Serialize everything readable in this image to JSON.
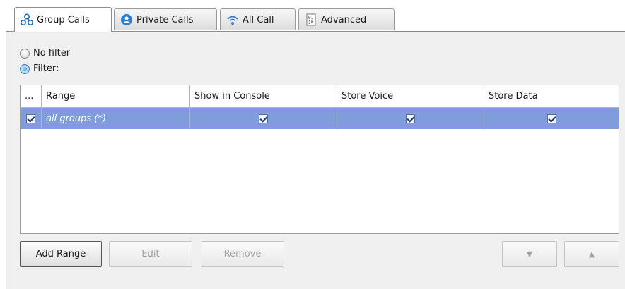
{
  "tabs": [
    {
      "label": "Group Calls",
      "icon": "group-icon",
      "active": true
    },
    {
      "label": "Private Calls",
      "icon": "person-icon",
      "active": false
    },
    {
      "label": "All Call",
      "icon": "broadcast-icon",
      "active": false
    },
    {
      "label": "Advanced",
      "icon": "binary-file-icon",
      "active": false
    }
  ],
  "filter": {
    "no_filter_label": "No filter",
    "filter_label": "Filter:",
    "selected": "filter"
  },
  "table": {
    "columns": [
      "...",
      "Range",
      "Show in Console",
      "Store Voice",
      "Store Data"
    ],
    "rows": [
      {
        "enabled": true,
        "range": "all groups (*)",
        "show_in_console": true,
        "store_voice": true,
        "store_data": true,
        "selected": true
      }
    ]
  },
  "buttons": {
    "add_range": "Add Range",
    "edit": "Edit",
    "remove": "Remove",
    "move_down": "▼",
    "move_up": "▲"
  },
  "colors": {
    "selection": "#7f9cdc",
    "tab_icon_blue": "#2a7fd4"
  }
}
